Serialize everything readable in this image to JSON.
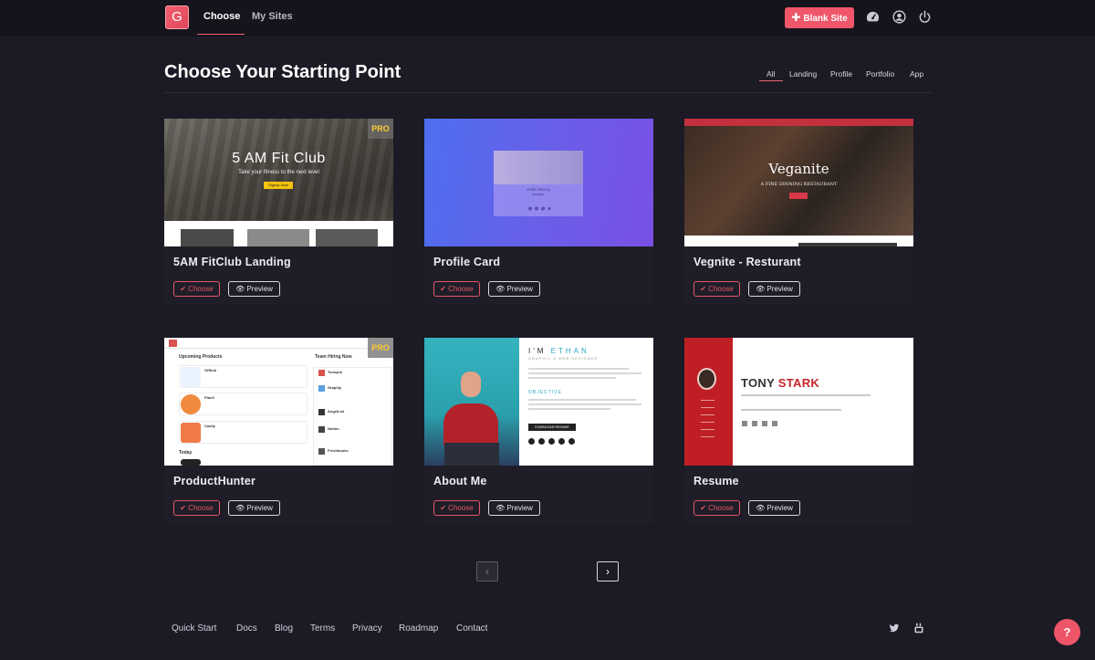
{
  "app": {
    "logo_letter": "G",
    "nav": {
      "choose": "Choose",
      "my_sites": "My Sites"
    },
    "blank_site_button": "Blank Site",
    "icons": [
      "dashboard-icon",
      "account-icon",
      "power-icon"
    ]
  },
  "header": {
    "title": "Choose Your Starting Point",
    "filters": [
      "All",
      "Landing",
      "Profile",
      "Portfolio",
      "App"
    ],
    "active_filter": "All"
  },
  "buttons": {
    "choose": "Choose",
    "preview": "Preview",
    "pro": "PRO"
  },
  "templates": [
    {
      "title": "5AM FitClub Landing",
      "pro": true,
      "thumb": {
        "headline": "5 AM Fit Club",
        "tagline": "Take your fitness to the next level",
        "cta": "Signup Now"
      }
    },
    {
      "title": "Profile Card",
      "pro": false,
      "thumb": {
        "name": "Justin Mccoy",
        "role": "designer"
      }
    },
    {
      "title": "Vegnite - Resturant",
      "pro": false,
      "thumb": {
        "headline": "Veganite",
        "tagline": "A FINE DINNING RESTAURANT",
        "cta": "Explore"
      }
    },
    {
      "title": "ProductHunter",
      "pro": true,
      "thumb": {
        "upcoming": "Upcoming Products",
        "hiring": "Team Hiring Now",
        "today": "Today",
        "products": [
          "Offhub",
          "Plan9",
          "Castly"
        ],
        "jobs": [
          "Toxicpin",
          "Graphly",
          "AngelList",
          "Notion",
          "Freshbooks"
        ]
      }
    },
    {
      "title": "About Me",
      "pro": false,
      "thumb": {
        "im": "I'M",
        "name": "ETHAN",
        "role": "GRAPHIC & WEB DESIGNER",
        "objective": "OBJECTIVE",
        "download": "DOWNLOAD RESUME"
      }
    },
    {
      "title": "Resume",
      "pro": false,
      "thumb": {
        "first": "TONY",
        "last": "STARK"
      }
    }
  ],
  "pagination": {
    "prev": "‹",
    "next": "›"
  },
  "footer": {
    "links": [
      "Quick Start",
      "Docs",
      "Blog",
      "Terms",
      "Privacy",
      "Roadmap",
      "Contact"
    ],
    "social": [
      "twitter-icon",
      "youtube-icon"
    ],
    "help": "?"
  },
  "colors": {
    "accent": "#f0566a",
    "background": "#1c1b25",
    "topbar": "#15141c",
    "card": "#1f1e28"
  }
}
